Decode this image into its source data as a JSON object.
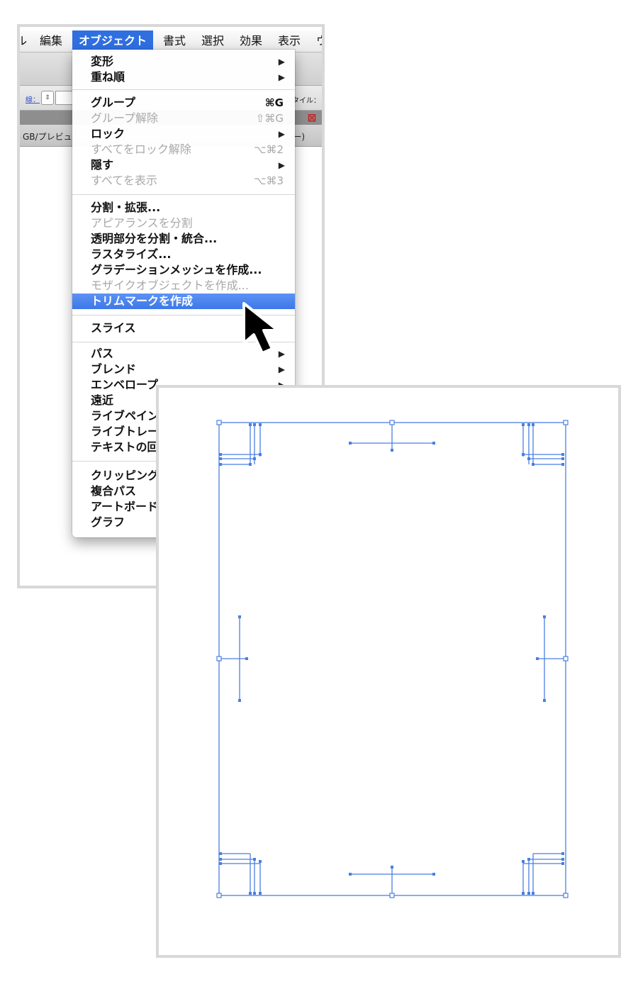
{
  "menubar": {
    "items": [
      {
        "label": "ル",
        "active": false
      },
      {
        "label": "編集",
        "active": false
      },
      {
        "label": "オブジェクト",
        "active": true
      },
      {
        "label": "書式",
        "active": false
      },
      {
        "label": "選択",
        "active": false
      },
      {
        "label": "効果",
        "active": false
      },
      {
        "label": "表示",
        "active": false
      },
      {
        "label": "ウ",
        "active": false
      }
    ]
  },
  "toolbar": {
    "stroke_label": "線：",
    "style_label": "スタイル："
  },
  "document": {
    "tab_left": "GB/プレビュ",
    "tab_right": "ー)"
  },
  "menu": {
    "groups": [
      {
        "items": [
          {
            "label": "変形",
            "submenu": true,
            "enabled": true
          },
          {
            "label": "重ね順",
            "submenu": true,
            "enabled": true
          }
        ]
      },
      {
        "items": [
          {
            "label": "グループ",
            "shortcut": "⌘G",
            "enabled": true
          },
          {
            "label": "グループ解除",
            "shortcut": "⇧⌘G",
            "enabled": false
          },
          {
            "label": "ロック",
            "submenu": true,
            "enabled": true
          },
          {
            "label": "すべてをロック解除",
            "shortcut": "⌥⌘2",
            "enabled": false
          },
          {
            "label": "隠す",
            "submenu": true,
            "enabled": true
          },
          {
            "label": "すべてを表示",
            "shortcut": "⌥⌘3",
            "enabled": false
          }
        ]
      },
      {
        "items": [
          {
            "label": "分割・拡張...",
            "enabled": true
          },
          {
            "label": "アピアランスを分割",
            "enabled": false
          },
          {
            "label": "透明部分を分割・統合...",
            "enabled": true
          },
          {
            "label": "ラスタライズ...",
            "enabled": true
          },
          {
            "label": "グラデーションメッシュを作成...",
            "enabled": true
          },
          {
            "label": "モザイクオブジェクトを作成...",
            "enabled": false
          },
          {
            "label": "トリムマークを作成",
            "enabled": true,
            "highlighted": true
          }
        ]
      },
      {
        "items": [
          {
            "label": "スライス",
            "submenu": true,
            "enabled": true
          }
        ]
      },
      {
        "items": [
          {
            "label": "パス",
            "submenu": true,
            "enabled": true
          },
          {
            "label": "ブレンド",
            "submenu": true,
            "enabled": true
          },
          {
            "label": "エンベロープ",
            "submenu": true,
            "enabled": true
          },
          {
            "label": "遠近",
            "submenu": true,
            "enabled": true
          },
          {
            "label": "ライブペイン",
            "submenu": true,
            "enabled": true
          },
          {
            "label": "ライブトレー",
            "submenu": true,
            "enabled": true
          },
          {
            "label": "テキストの回",
            "submenu": true,
            "enabled": true
          }
        ]
      },
      {
        "items": [
          {
            "label": "クリッピング",
            "submenu": true,
            "enabled": true
          },
          {
            "label": "複合パス",
            "submenu": true,
            "enabled": true
          },
          {
            "label": "アートボード",
            "submenu": true,
            "enabled": true
          },
          {
            "label": "グラフ",
            "submenu": true,
            "enabled": true
          }
        ]
      }
    ]
  },
  "colors": {
    "menu_highlight": "#3e78e8",
    "trim_line": "#4a7fe0",
    "frame_border": "#d8d8d8"
  }
}
